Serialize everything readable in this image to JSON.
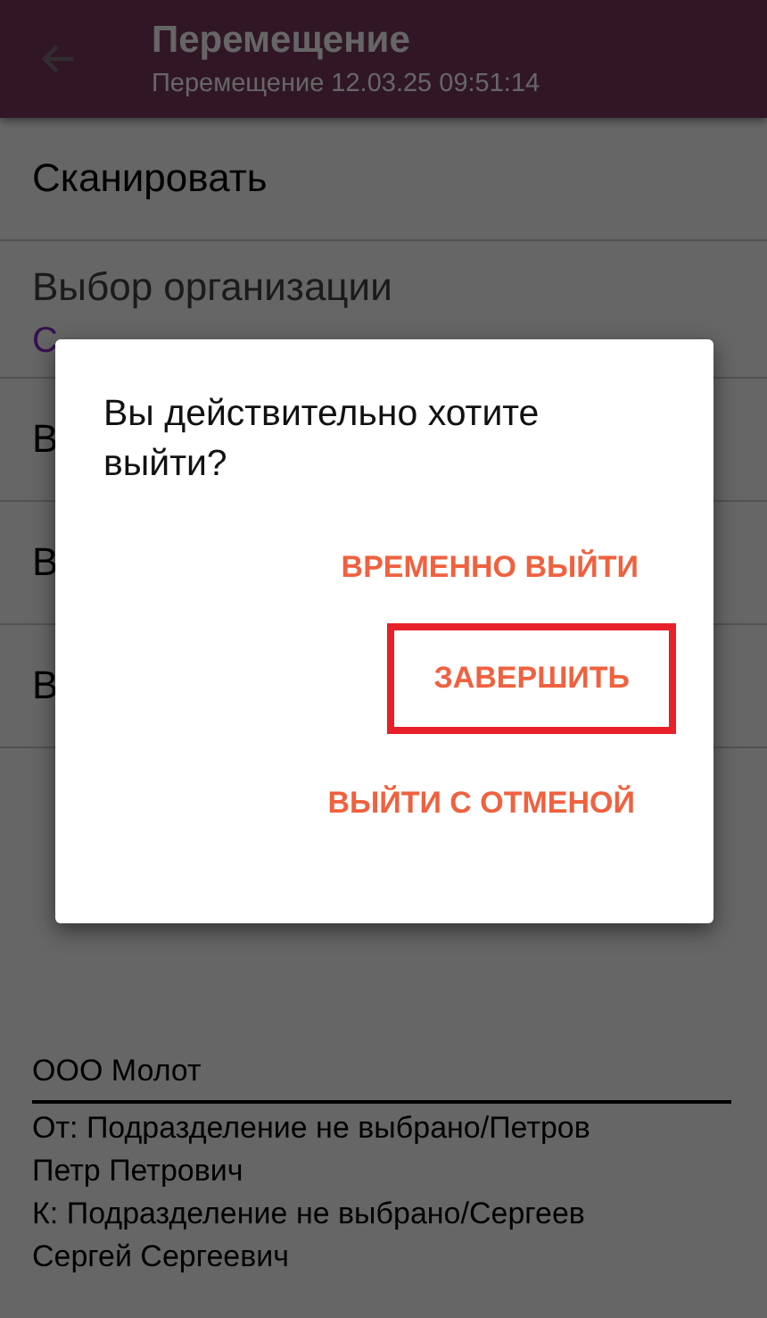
{
  "header": {
    "title": "Перемещение",
    "subtitle": "Перемещение 12.03.25 09:51:14"
  },
  "menu": [
    {
      "kind": "action",
      "label": "Сканировать"
    },
    {
      "kind": "field",
      "label": "Выбор организации",
      "value": "С"
    },
    {
      "kind": "action",
      "label": "В"
    },
    {
      "kind": "action",
      "label": "В"
    },
    {
      "kind": "action",
      "label": "В"
    }
  ],
  "footer": {
    "organization": "ООО Молот",
    "lines": [
      "От: Подразделение не выбрано/Петров",
      "Петр Петрович",
      "К: Подразделение не выбрано/Сергеев",
      "Сергей Сергеевич"
    ]
  },
  "dialog": {
    "message": "Вы действительно хотите выйти?",
    "actions": [
      {
        "label": "ВРЕМЕННО ВЫЙТИ",
        "highlighted": false
      },
      {
        "label": "ЗАВЕРШИТЬ",
        "highlighted": true
      },
      {
        "label": "ВЫЙТИ С ОТМЕНОЙ",
        "highlighted": false
      }
    ]
  }
}
